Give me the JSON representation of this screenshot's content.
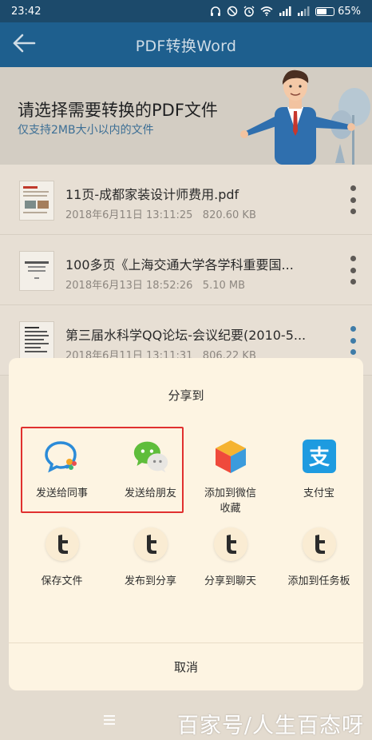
{
  "status_bar": {
    "time": "23:42",
    "battery_percent": "65%",
    "battery_level": 0.65
  },
  "header": {
    "title": "PDF转换Word",
    "back_icon": "arrow-left-icon"
  },
  "banner": {
    "title": "请选择需要转换的PDF文件",
    "subtitle": "仅支持2MB大小以内的文件"
  },
  "files": [
    {
      "name": "11页-成都家装设计师费用.pdf",
      "meta": "2018年6月11日 13:11:25   820.60 KB"
    },
    {
      "name": "100多页《上海交通大学各学科重要国...",
      "meta": "2018年6月13日 18:52:26   5.10 MB"
    },
    {
      "name": "第三届水科学QQ论坛-会议纪要(2010-5...",
      "meta": "2018年6月11日 13:11:31   806.22 KB"
    }
  ],
  "share_sheet": {
    "title": "分享到",
    "items": [
      {
        "label": "发送给同事",
        "icon": "work-chat-icon"
      },
      {
        "label": "发送给朋友",
        "icon": "wechat-icon"
      },
      {
        "label": "添加到微信收藏",
        "icon": "favorites-cube-icon"
      },
      {
        "label": "支付宝",
        "icon": "alipay-icon"
      },
      {
        "label": "保存文件",
        "icon": "t-app-icon"
      },
      {
        "label": "发布到分享",
        "icon": "t-app-icon"
      },
      {
        "label": "分享到聊天",
        "icon": "t-app-icon"
      },
      {
        "label": "添加到任务板",
        "icon": "t-app-icon"
      }
    ],
    "cancel_label": "取消"
  },
  "colors": {
    "header_bg": "#1e5f8e",
    "sheet_bg": "#fdf4e2",
    "highlight": "#e0302f",
    "accent_blue": "#3d6f95"
  },
  "watermark": "百家号/人生百态呀"
}
